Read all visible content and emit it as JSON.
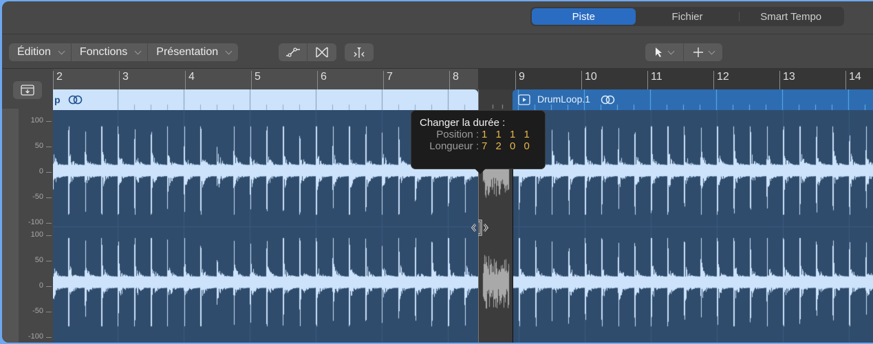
{
  "header": {
    "tabs": [
      {
        "label": "Piste",
        "active": true
      },
      {
        "label": "Fichier",
        "active": false
      },
      {
        "label": "Smart Tempo",
        "active": false
      }
    ]
  },
  "toolbar": {
    "menus": [
      {
        "label": "Édition"
      },
      {
        "label": "Fonctions"
      },
      {
        "label": "Présentation"
      }
    ],
    "icon_buttons": [
      "flex-curve-icon",
      "crossfade-icon",
      "snap-marker-icon"
    ],
    "tools": [
      {
        "icon": "pointer-tool-icon"
      },
      {
        "icon": "crosshair-tool-icon"
      }
    ]
  },
  "ruler": {
    "bars": [
      "2",
      "3",
      "4",
      "5",
      "6",
      "7",
      "8",
      "9",
      "10",
      "11",
      "12",
      "13",
      "14"
    ]
  },
  "regions": [
    {
      "name": "p",
      "partial": true,
      "stereo": true,
      "selected": false
    },
    {
      "name": "DrumLoop.1",
      "stereo": true,
      "selected": true
    }
  ],
  "amplitude_scale": {
    "channel_1": [
      "100",
      "50",
      "0",
      "-50",
      "-100"
    ],
    "channel_2": [
      "100",
      "50",
      "0",
      "-50",
      "-100"
    ]
  },
  "tooltip": {
    "title": "Changer la durée :",
    "position_label": "Position :",
    "position_value": "1 1 1 1",
    "length_label": "Longueur :",
    "length_value": "7 2 0 0"
  },
  "colors": {
    "accent": "#2a6cc2",
    "waveform": "#cce3fb",
    "region_body": "#304c6d",
    "selected_region_header": "#2d6cb0",
    "tooltip_value": "#e4b84a"
  }
}
